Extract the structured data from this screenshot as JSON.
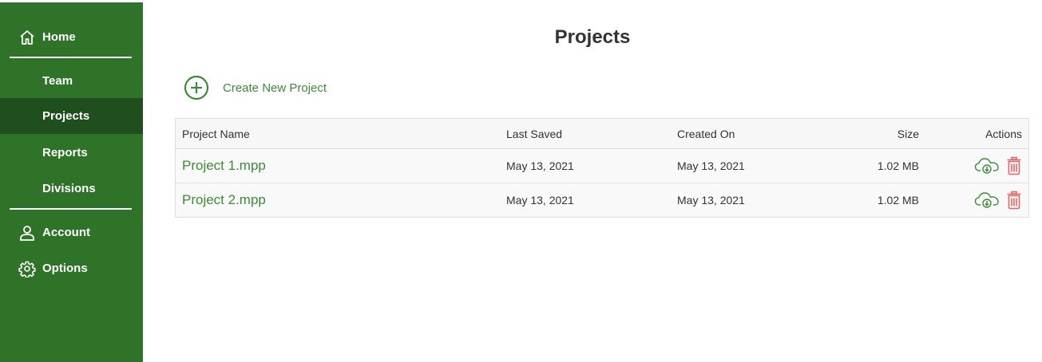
{
  "sidebar": {
    "items": [
      {
        "label": "Home",
        "icon": "home-icon"
      },
      {
        "label": "Team"
      },
      {
        "label": "Projects",
        "active": true
      },
      {
        "label": "Reports"
      },
      {
        "label": "Divisions"
      },
      {
        "label": "Account",
        "icon": "user-icon"
      },
      {
        "label": "Options",
        "icon": "gear-icon"
      }
    ]
  },
  "main": {
    "title": "Projects",
    "create_label": "Create New Project",
    "table": {
      "headers": {
        "name": "Project Name",
        "saved": "Last Saved",
        "created": "Created On",
        "size": "Size",
        "actions": "Actions"
      },
      "rows": [
        {
          "name": "Project 1.mpp",
          "saved": "May 13, 2021",
          "created": "May 13, 2021",
          "size": "1.02 MB"
        },
        {
          "name": "Project 2.mpp",
          "saved": "May 13, 2021",
          "created": "May 13, 2021",
          "size": "1.02 MB"
        }
      ]
    }
  },
  "colors": {
    "sidebar_bg": "#2e7328",
    "sidebar_active": "#1f4f1d",
    "accent_green": "#3d8b37",
    "delete_red": "#e06666"
  }
}
